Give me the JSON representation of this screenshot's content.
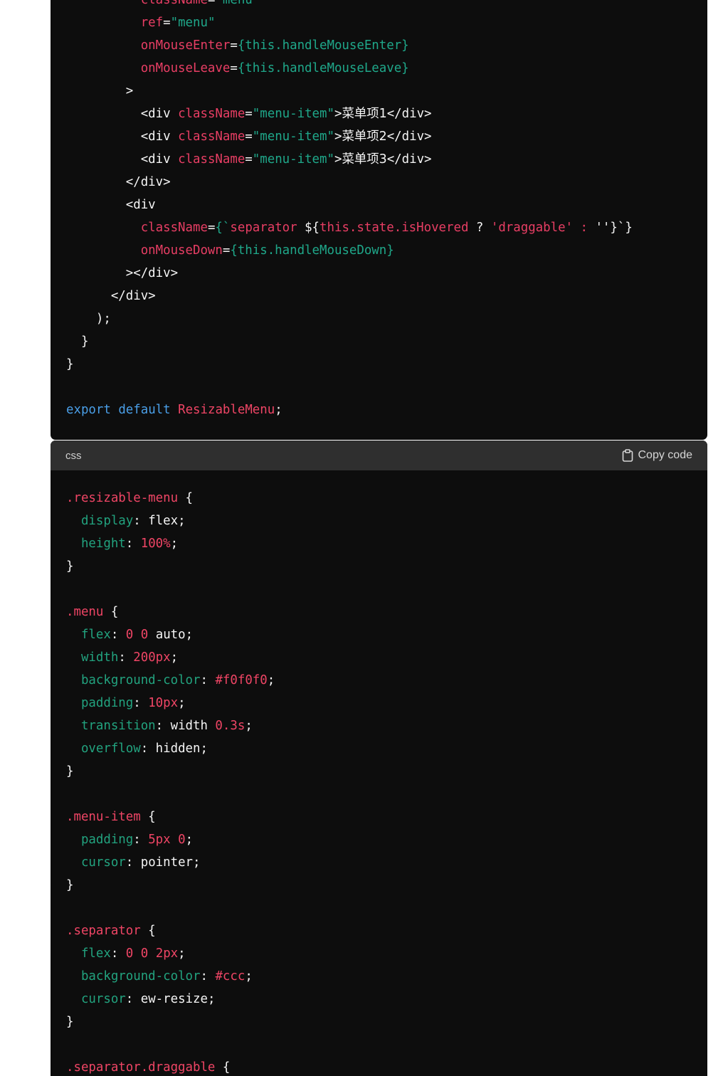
{
  "js_block": {
    "lines": [
      [
        [
          "          ",
          ""
        ],
        [
          "className",
          "attr"
        ],
        [
          "=",
          ""
        ],
        [
          "\"menu\"",
          "str"
        ]
      ],
      [
        [
          "          ",
          ""
        ],
        [
          "ref",
          "attr"
        ],
        [
          "=",
          ""
        ],
        [
          "\"menu\"",
          "str"
        ]
      ],
      [
        [
          "          ",
          ""
        ],
        [
          "onMouseEnter",
          "attr"
        ],
        [
          "=",
          ""
        ],
        [
          "{this.handleMouseEnter}",
          "str"
        ]
      ],
      [
        [
          "          ",
          ""
        ],
        [
          "onMouseLeave",
          "attr"
        ],
        [
          "=",
          ""
        ],
        [
          "{this.handleMouseLeave}",
          "str"
        ]
      ],
      [
        [
          "        >",
          ""
        ]
      ],
      [
        [
          "          <div ",
          ""
        ],
        [
          "className",
          "attr"
        ],
        [
          "=",
          ""
        ],
        [
          "\"menu-item\"",
          "str"
        ],
        [
          ">",
          ""
        ],
        [
          "菜单项1",
          "cjk"
        ],
        [
          "</div>",
          ""
        ]
      ],
      [
        [
          "          <div ",
          ""
        ],
        [
          "className",
          "attr"
        ],
        [
          "=",
          ""
        ],
        [
          "\"menu-item\"",
          "str"
        ],
        [
          ">",
          ""
        ],
        [
          "菜单项2",
          "cjk"
        ],
        [
          "</div>",
          ""
        ]
      ],
      [
        [
          "          <div ",
          ""
        ],
        [
          "className",
          "attr"
        ],
        [
          "=",
          ""
        ],
        [
          "\"menu-item\"",
          "str"
        ],
        [
          ">",
          ""
        ],
        [
          "菜单项3",
          "cjk"
        ],
        [
          "</div>",
          ""
        ]
      ],
      [
        [
          "        </div>",
          ""
        ]
      ],
      [
        [
          "        <div",
          ""
        ]
      ],
      [
        [
          "          ",
          ""
        ],
        [
          "className",
          "attr"
        ],
        [
          "=",
          ""
        ],
        [
          "{`",
          "str"
        ],
        [
          "separator ",
          "attr"
        ],
        [
          "${",
          ""
        ],
        [
          "this.state.isHovered",
          "attr"
        ],
        [
          " ? ",
          ""
        ],
        [
          "'draggable'",
          "attr"
        ],
        [
          " : ",
          "attr"
        ],
        [
          "''",
          ""
        ],
        [
          "}`}",
          ""
        ]
      ],
      [
        [
          "          ",
          ""
        ],
        [
          "onMouseDown",
          "attr"
        ],
        [
          "=",
          ""
        ],
        [
          "{this.handleMouseDown}",
          "str"
        ]
      ],
      [
        [
          "        ></div>",
          ""
        ]
      ],
      [
        [
          "      </div>",
          ""
        ]
      ],
      [
        [
          "    );",
          ""
        ]
      ],
      [
        [
          "  }",
          ""
        ]
      ],
      [
        [
          "}",
          ""
        ]
      ],
      [
        [
          "",
          ""
        ]
      ],
      [
        [
          "export",
          "kw"
        ],
        [
          " ",
          ""
        ],
        [
          "default",
          "kw"
        ],
        [
          " ",
          ""
        ],
        [
          "ResizableMenu",
          "ident"
        ],
        [
          ";",
          ""
        ]
      ]
    ]
  },
  "css_block": {
    "language": "css",
    "copy_label": "Copy code",
    "lines": [
      [
        [
          ".resizable-menu",
          "sel"
        ],
        [
          " {",
          ""
        ]
      ],
      [
        [
          "  ",
          ""
        ],
        [
          "display",
          "prop"
        ],
        [
          ": flex;",
          ""
        ]
      ],
      [
        [
          "  ",
          ""
        ],
        [
          "height",
          "prop"
        ],
        [
          ": ",
          ""
        ],
        [
          "100%",
          "num"
        ],
        [
          ";",
          ""
        ]
      ],
      [
        [
          "}",
          ""
        ]
      ],
      [
        [
          "",
          ""
        ]
      ],
      [
        [
          ".menu",
          "sel"
        ],
        [
          " {",
          ""
        ]
      ],
      [
        [
          "  ",
          ""
        ],
        [
          "flex",
          "prop"
        ],
        [
          ": ",
          ""
        ],
        [
          "0",
          "num"
        ],
        [
          " ",
          ""
        ],
        [
          "0",
          "num"
        ],
        [
          " auto;",
          ""
        ]
      ],
      [
        [
          "  ",
          ""
        ],
        [
          "width",
          "prop"
        ],
        [
          ": ",
          ""
        ],
        [
          "200px",
          "num"
        ],
        [
          ";",
          ""
        ]
      ],
      [
        [
          "  ",
          ""
        ],
        [
          "background-color",
          "prop"
        ],
        [
          ": ",
          ""
        ],
        [
          "#f0f0f0",
          "num"
        ],
        [
          ";",
          ""
        ]
      ],
      [
        [
          "  ",
          ""
        ],
        [
          "padding",
          "prop"
        ],
        [
          ": ",
          ""
        ],
        [
          "10px",
          "num"
        ],
        [
          ";",
          ""
        ]
      ],
      [
        [
          "  ",
          ""
        ],
        [
          "transition",
          "prop"
        ],
        [
          ": width ",
          ""
        ],
        [
          "0.3s",
          "num"
        ],
        [
          ";",
          ""
        ]
      ],
      [
        [
          "  ",
          ""
        ],
        [
          "overflow",
          "prop"
        ],
        [
          ": hidden;",
          ""
        ]
      ],
      [
        [
          "}",
          ""
        ]
      ],
      [
        [
          "",
          ""
        ]
      ],
      [
        [
          ".menu-item",
          "sel"
        ],
        [
          " {",
          ""
        ]
      ],
      [
        [
          "  ",
          ""
        ],
        [
          "padding",
          "prop"
        ],
        [
          ": ",
          ""
        ],
        [
          "5px",
          "num"
        ],
        [
          " ",
          ""
        ],
        [
          "0",
          "num"
        ],
        [
          ";",
          ""
        ]
      ],
      [
        [
          "  ",
          ""
        ],
        [
          "cursor",
          "prop"
        ],
        [
          ": pointer;",
          ""
        ]
      ],
      [
        [
          "}",
          ""
        ]
      ],
      [
        [
          "",
          ""
        ]
      ],
      [
        [
          ".separator",
          "sel"
        ],
        [
          " {",
          ""
        ]
      ],
      [
        [
          "  ",
          ""
        ],
        [
          "flex",
          "prop"
        ],
        [
          ": ",
          ""
        ],
        [
          "0",
          "num"
        ],
        [
          " ",
          ""
        ],
        [
          "0",
          "num"
        ],
        [
          " ",
          ""
        ],
        [
          "2px",
          "num"
        ],
        [
          ";",
          ""
        ]
      ],
      [
        [
          "  ",
          ""
        ],
        [
          "background-color",
          "prop"
        ],
        [
          ": ",
          ""
        ],
        [
          "#ccc",
          "num"
        ],
        [
          ";",
          ""
        ]
      ],
      [
        [
          "  ",
          ""
        ],
        [
          "cursor",
          "prop"
        ],
        [
          ": ew-resize;",
          ""
        ]
      ],
      [
        [
          "}",
          ""
        ]
      ],
      [
        [
          "",
          ""
        ]
      ],
      [
        [
          ".separator.draggable",
          "sel"
        ],
        [
          " {",
          ""
        ]
      ]
    ]
  },
  "colors": {
    "code_bg": "#0d0d0d",
    "header_bg": "#2f2f2f",
    "attr": "#e83e64",
    "string": "#1fa88a",
    "keyword": "#4a9fe8",
    "property": "#22a37f"
  }
}
